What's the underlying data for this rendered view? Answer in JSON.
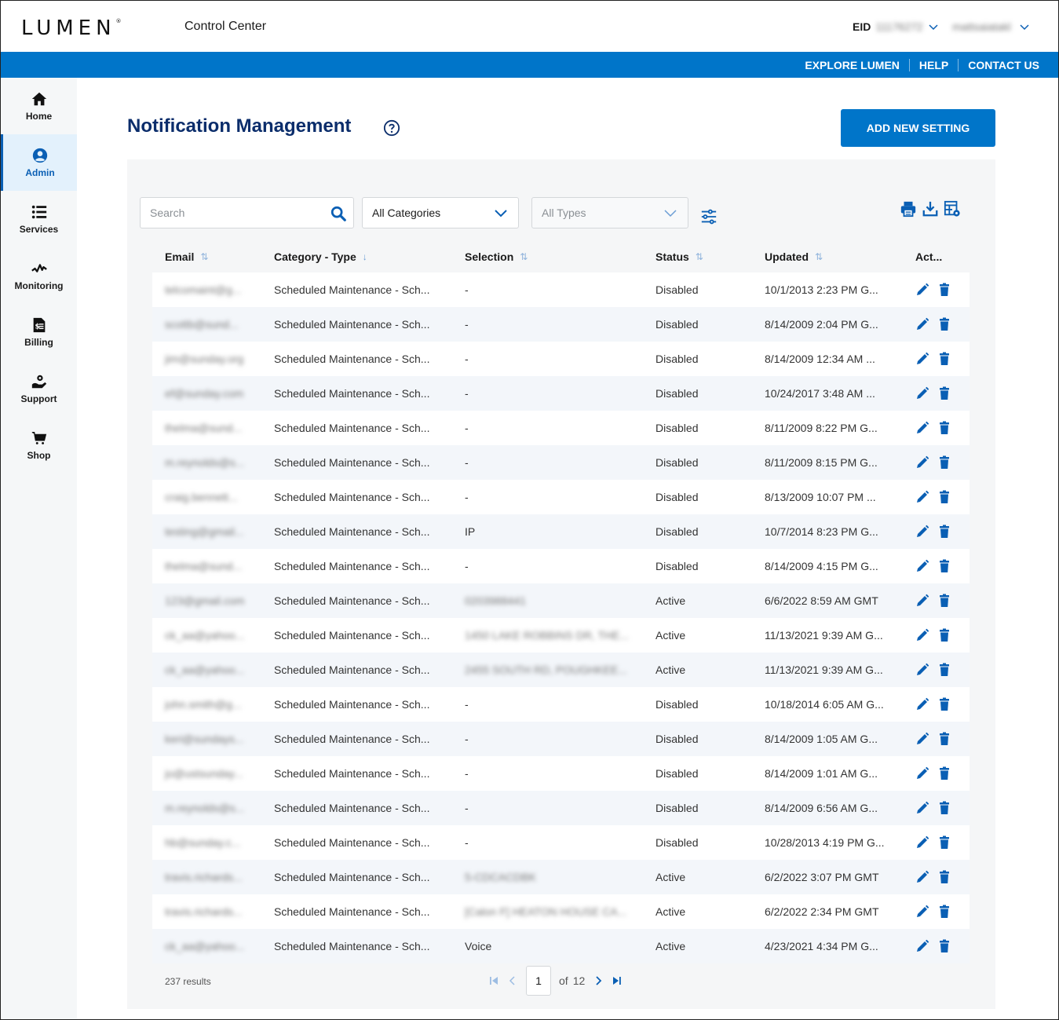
{
  "header": {
    "logo": "LUMEN",
    "app_title": "Control Center",
    "eid_label": "EID",
    "eid_value": "11176272",
    "username": "mattsaiatakl"
  },
  "topnav": {
    "links": [
      "EXPLORE LUMEN",
      "HELP",
      "CONTACT US"
    ]
  },
  "sidebar": {
    "items": [
      {
        "label": "Home",
        "icon": "home-icon",
        "active": false
      },
      {
        "label": "Admin",
        "icon": "user-circle-icon",
        "active": true
      },
      {
        "label": "Services",
        "icon": "list-icon",
        "active": false
      },
      {
        "label": "Monitoring",
        "icon": "pulse-icon",
        "active": false
      },
      {
        "label": "Billing",
        "icon": "invoice-icon",
        "active": false
      },
      {
        "label": "Support",
        "icon": "support-hand-gear-icon",
        "active": false
      },
      {
        "label": "Shop",
        "icon": "cart-icon",
        "active": false
      }
    ]
  },
  "page": {
    "title": "Notification Management",
    "add_button": "ADD NEW SETTING"
  },
  "filters": {
    "search_placeholder": "Search",
    "category": "All Categories",
    "type": "All Types"
  },
  "colors": {
    "brand_blue": "#0075c9",
    "title_navy": "#0b2d6b",
    "action_blue": "#0a5fb4"
  },
  "table": {
    "columns": [
      "Email",
      "Category - Type",
      "Selection",
      "Status",
      "Updated",
      "Act..."
    ],
    "rows": [
      {
        "email": "telcomaint@g...",
        "category": "Scheduled Maintenance - Sch...",
        "selection": "-",
        "status": "Disabled",
        "updated": "10/1/2013 2:23 PM G..."
      },
      {
        "email": "scottb@sund...",
        "category": "Scheduled Maintenance - Sch...",
        "selection": "-",
        "status": "Disabled",
        "updated": "8/14/2009 2:04 PM G..."
      },
      {
        "email": "jim@sunday.org",
        "category": "Scheduled Maintenance - Sch...",
        "selection": "-",
        "status": "Disabled",
        "updated": "8/14/2009 12:34 AM ..."
      },
      {
        "email": "ef@sunday.com",
        "category": "Scheduled Maintenance - Sch...",
        "selection": "-",
        "status": "Disabled",
        "updated": "10/24/2017 3:48 AM ..."
      },
      {
        "email": "thelma@sund...",
        "category": "Scheduled Maintenance - Sch...",
        "selection": "-",
        "status": "Disabled",
        "updated": "8/11/2009 8:22 PM G..."
      },
      {
        "email": "m.reynolds@s...",
        "category": "Scheduled Maintenance - Sch...",
        "selection": "-",
        "status": "Disabled",
        "updated": "8/11/2009 8:15 PM G..."
      },
      {
        "email": "craig.bennett...",
        "category": "Scheduled Maintenance - Sch...",
        "selection": "-",
        "status": "Disabled",
        "updated": "8/13/2009 10:07 PM ..."
      },
      {
        "email": "testing@gmail...",
        "category": "Scheduled Maintenance - Sch...",
        "selection": "IP",
        "status": "Disabled",
        "updated": "10/7/2014 8:23 PM G..."
      },
      {
        "email": "thelma@sund...",
        "category": "Scheduled Maintenance - Sch...",
        "selection": "-",
        "status": "Disabled",
        "updated": "8/14/2009 4:15 PM G..."
      },
      {
        "email": "123@gmail.com",
        "category": "Scheduled Maintenance - Sch...",
        "selection": "0203988441",
        "selection_blurred": true,
        "status": "Active",
        "updated": "6/6/2022 8:59 AM GMT"
      },
      {
        "email": "ck_aa@yahoo...",
        "category": "Scheduled Maintenance - Sch...",
        "selection": "1450 LAKE ROBBINS DR, THE...",
        "selection_blurred": true,
        "status": "Active",
        "updated": "11/13/2021 9:39 AM G..."
      },
      {
        "email": "ck_aa@yahoo...",
        "category": "Scheduled Maintenance - Sch...",
        "selection": "2455 SOUTH RD, POUGHKEE...",
        "selection_blurred": true,
        "status": "Active",
        "updated": "11/13/2021 9:39 AM G..."
      },
      {
        "email": "john.smith@g...",
        "category": "Scheduled Maintenance - Sch...",
        "selection": "-",
        "status": "Disabled",
        "updated": "10/18/2014 6:05 AM G..."
      },
      {
        "email": "keri@sundays...",
        "category": "Scheduled Maintenance - Sch...",
        "selection": "-",
        "status": "Disabled",
        "updated": "8/14/2009 1:05 AM G..."
      },
      {
        "email": "jo@ustsunday...",
        "category": "Scheduled Maintenance - Sch...",
        "selection": "-",
        "status": "Disabled",
        "updated": "8/14/2009 1:01 AM G..."
      },
      {
        "email": "m.reynolds@s...",
        "category": "Scheduled Maintenance - Sch...",
        "selection": "-",
        "status": "Disabled",
        "updated": "8/14/2009 6:56 AM G..."
      },
      {
        "email": "hb@sunday.c...",
        "category": "Scheduled Maintenance - Sch...",
        "selection": "-",
        "status": "Disabled",
        "updated": "10/28/2013 4:19 PM G..."
      },
      {
        "email": "travis.richards...",
        "category": "Scheduled Maintenance - Sch...",
        "selection": "5-CDCACDBK",
        "selection_blurred": true,
        "status": "Active",
        "updated": "6/2/2022 3:07 PM GMT"
      },
      {
        "email": "travis.richards...",
        "category": "Scheduled Maintenance - Sch...",
        "selection": "[Calon F] HEATON HOUSE CA...",
        "selection_blurred": true,
        "status": "Active",
        "updated": "6/2/2022 2:34 PM GMT"
      },
      {
        "email": "ck_aa@yahoo...",
        "category": "Scheduled Maintenance - Sch...",
        "selection": "Voice",
        "status": "Active",
        "updated": "4/23/2021 4:34 PM G..."
      }
    ]
  },
  "pagination": {
    "results": "237 results",
    "current_page": "1",
    "of_label": "of",
    "total_pages": "12"
  }
}
